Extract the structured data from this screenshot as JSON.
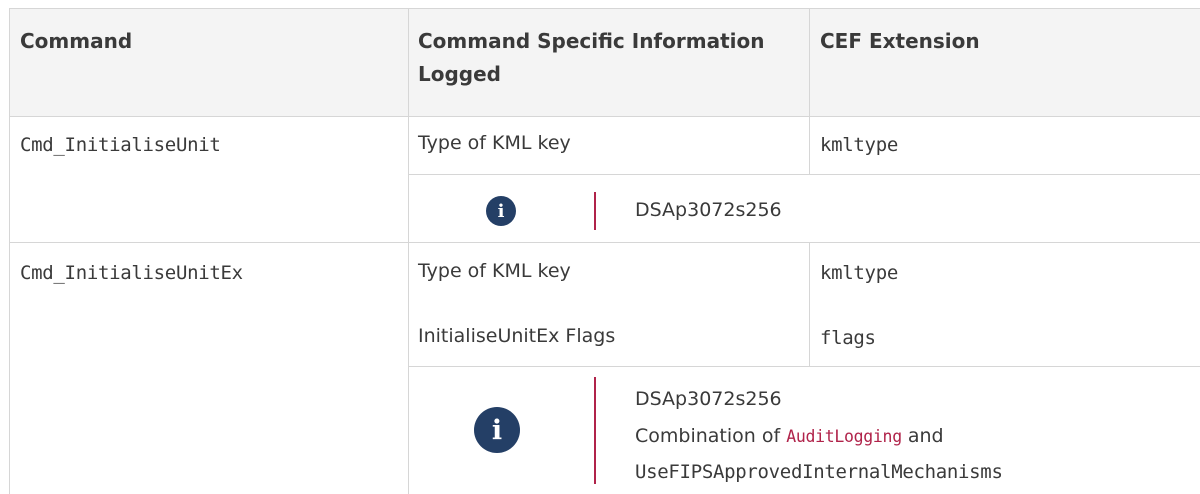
{
  "table": {
    "headers": {
      "command": "Command",
      "info_line1": "Command Specific Information",
      "info_line2": "Logged",
      "cef": "CEF Extension"
    },
    "rows": [
      {
        "command": "Cmd_InitialiseUnit",
        "items": [
          {
            "info": "Type of KML key",
            "cef": "kmltype"
          }
        ],
        "note": {
          "icon": "info-icon",
          "line1": "DSAp3072s256"
        }
      },
      {
        "command": "Cmd_InitialiseUnitEx",
        "items": [
          {
            "info": "Type of KML key",
            "cef": "kmltype"
          },
          {
            "info": "InitialiseUnitEx Flags",
            "cef": "flags"
          }
        ],
        "note": {
          "icon": "info-icon",
          "line1": "DSAp3072s256",
          "line2_prefix": "Combination of ",
          "code1": "AuditLogging",
          "line2_suffix": " and",
          "code2": "UseFIPSApprovedInternalMechanisms"
        }
      }
    ]
  },
  "colors": {
    "code": "#b0234a",
    "icon": "#243f66",
    "border": "#d6d6d6",
    "header_bg": "#f4f4f4"
  }
}
